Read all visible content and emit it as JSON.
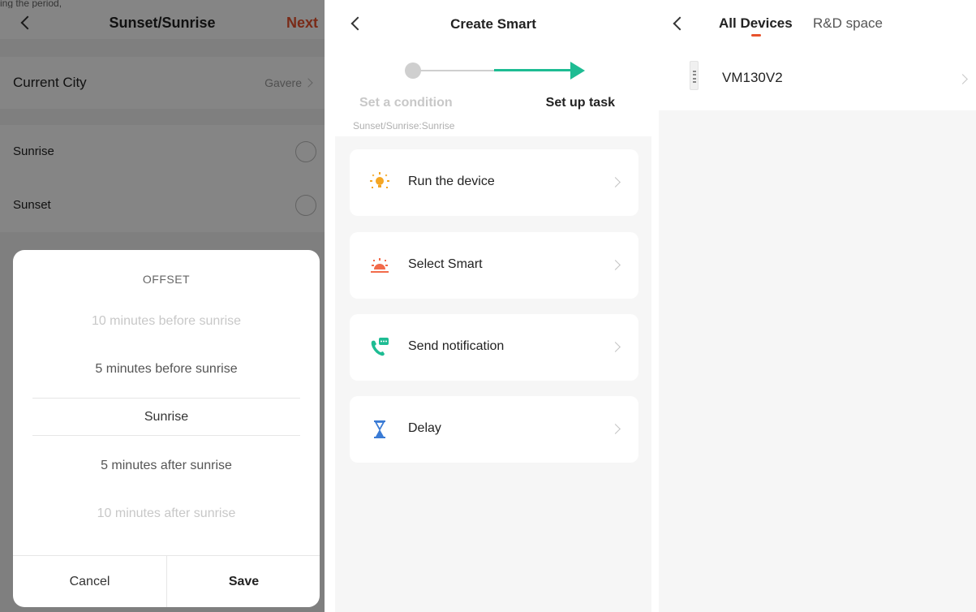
{
  "screen1": {
    "caption_partial": "ing the period,",
    "title": "Sunset/Sunrise",
    "next_label": "Next",
    "city": {
      "label": "Current City",
      "value": "Gavere"
    },
    "options": [
      "Sunrise",
      "Sunset"
    ],
    "offset_sheet": {
      "title": "OFFSET",
      "items": [
        "10 minutes before sunrise",
        "5 minutes before sunrise",
        "Sunrise",
        "5 minutes after sunrise",
        "10 minutes after sunrise"
      ],
      "selected_index": 2,
      "cancel_label": "Cancel",
      "save_label": "Save"
    }
  },
  "screen2": {
    "title": "Create Smart",
    "steps": [
      "Set a condition",
      "Set up task"
    ],
    "condition_summary": "Sunset/Sunrise:Sunrise",
    "tasks": [
      {
        "label": "Run the device",
        "icon": "light-bulb-icon",
        "color": "#f5a623"
      },
      {
        "label": "Select Smart",
        "icon": "sunrise-icon",
        "color": "#f26b4b"
      },
      {
        "label": "Send notification",
        "icon": "phone-message-icon",
        "color": "#1ebc93"
      },
      {
        "label": "Delay",
        "icon": "hourglass-icon",
        "color": "#3a7bd5"
      }
    ]
  },
  "screen3": {
    "tabs": [
      "All Devices",
      "R&D space"
    ],
    "active_tab": 0,
    "devices": [
      {
        "name": "VM130V2",
        "icon": "device-switch-icon"
      }
    ]
  },
  "colors": {
    "accent_orange": "#e8522c",
    "accent_green": "#1ebc93"
  }
}
